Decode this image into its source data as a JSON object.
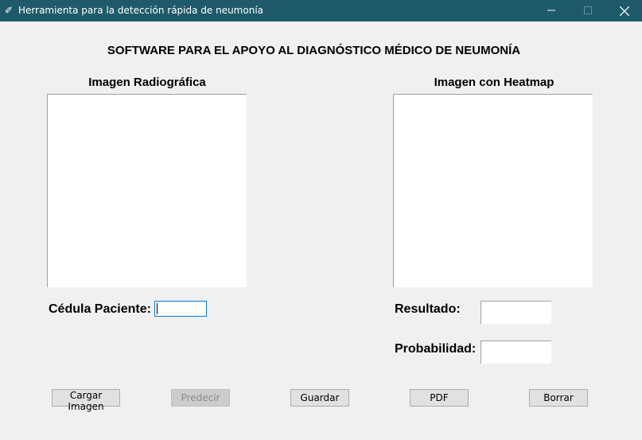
{
  "window": {
    "title": "Herramienta para la detección rápida de neumonía"
  },
  "header": {
    "title": "SOFTWARE PARA EL APOYO AL DIAGNÓSTICO MÉDICO DE NEUMONÍA"
  },
  "panels": {
    "left_label": "Imagen Radiográfica",
    "right_label": "Imagen con Heatmap"
  },
  "form": {
    "cedula_label": "Cédula Paciente:",
    "cedula_value": "",
    "resultado_label": "Resultado:",
    "resultado_value": "",
    "probabilidad_label": "Probabilidad:",
    "probabilidad_value": ""
  },
  "buttons": {
    "cargar": "Cargar Imagen",
    "predecir": "Predecir",
    "guardar": "Guardar",
    "pdf": "PDF",
    "borrar": "Borrar"
  },
  "colors": {
    "titlebar": "#1e5a6a",
    "background": "#f0f0f0",
    "focus": "#0078d7"
  }
}
